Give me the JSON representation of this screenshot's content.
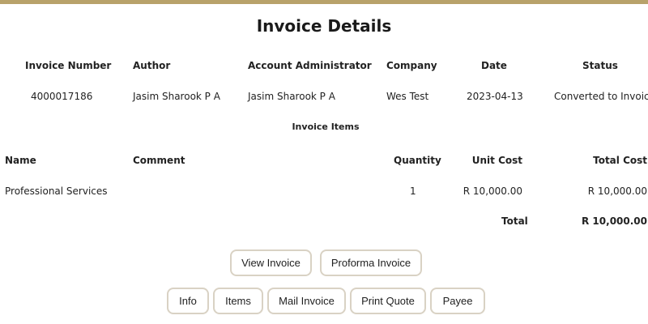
{
  "page_title": "Invoice Details",
  "invoice": {
    "headers": {
      "invoice_number": "Invoice Number",
      "author": "Author",
      "account_admin": "Account Administrator",
      "company": "Company",
      "date": "Date",
      "status": "Status"
    },
    "values": {
      "invoice_number": "4000017186",
      "author": "Jasim Sharook P A",
      "account_admin": "Jasim Sharook P A",
      "company": "Wes Test",
      "date": "2023-04-13",
      "status": "Converted to Invoice"
    }
  },
  "items_section": {
    "title": "Invoice Items",
    "headers": {
      "name": "Name",
      "comment": "Comment",
      "quantity": "Quantity",
      "unit_cost": "Unit Cost",
      "total_cost": "Total Cost"
    },
    "rows": [
      {
        "name": "Professional Services",
        "comment": "",
        "quantity": "1",
        "unit_cost": "R 10,000.00",
        "total_cost": "R 10,000.00"
      }
    ],
    "total_label": "Total",
    "total_value": "R 10,000.00"
  },
  "buttons": {
    "view_invoice": "View Invoice",
    "proforma_invoice": "Proforma Invoice",
    "info": "Info",
    "items": "Items",
    "mail_invoice": "Mail Invoice",
    "print_quote": "Print Quote",
    "payee": "Payee"
  },
  "colors": {
    "accent_bar": "#b8a26a",
    "button_border": "#d9d2c4"
  }
}
